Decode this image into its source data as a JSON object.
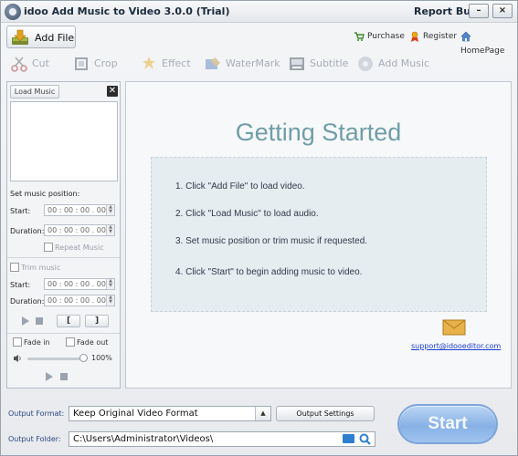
{
  "window": {
    "title": "idoo Add Music to Video 3.0.0 (Trial)",
    "report_bugs": "Report Bugs",
    "minimize": "–",
    "close": "×"
  },
  "toolbar": {
    "add_file": "Add File",
    "links": [
      {
        "label": "Purchase",
        "icon": "cart-icon"
      },
      {
        "label": "Register",
        "icon": "register-icon"
      },
      {
        "label": "HomePage",
        "icon": "home-icon"
      }
    ],
    "tools": [
      {
        "label": "Cut",
        "icon": "scissors-icon"
      },
      {
        "label": "Crop",
        "icon": "crop-icon"
      },
      {
        "label": "Effect",
        "icon": "effect-icon"
      },
      {
        "label": "WaterMark",
        "icon": "watermark-icon"
      },
      {
        "label": "Subtitle",
        "icon": "subtitle-icon"
      },
      {
        "label": "Add Music",
        "icon": "music-disc-icon"
      }
    ]
  },
  "left_panel": {
    "load_music": "Load Music",
    "close": "✕",
    "set_position_label": "Set music position:",
    "start_label": "Start:",
    "duration_label": "Duration:",
    "start_value": "00 : 00 : 00 . 000",
    "duration_value": "00 : 00 : 00 . 000",
    "repeat_music": "Repeat Music",
    "trim_music": "Trim music",
    "trim_start_label": "Start:",
    "trim_duration_label": "Duration:",
    "trim_start_value": "00 : 00 : 00 . 000",
    "trim_duration_value": "00 : 00 : 00 . 000",
    "mark_in": "[",
    "mark_out": "]",
    "fade_in": "Fade in",
    "fade_out": "Fade out",
    "volume_display": "100%",
    "volume_level": 1.0
  },
  "main": {
    "title": "Getting Started",
    "steps": [
      "1. Click \"Add File\" to load video.",
      "2. Click \"Load Music\" to load audio.",
      "3. Set music position or trim music if requested.",
      "4. Click \"Start\" to begin adding music to video."
    ],
    "support_email": "support@idooeditor.com"
  },
  "bottom": {
    "output_format_label": "Output Format:",
    "output_format_value": "Keep Original Video Format",
    "output_settings": "Output Settings",
    "output_folder_label": "Output Folder:",
    "output_folder_value": "C:\\Users\\Administrator\\Videos\\",
    "start": "Start"
  },
  "colors": {
    "title_text": "#6f9ea8",
    "start_button": "#87b1e6",
    "link_blue": "#1a3fd1",
    "disabled_tool": "#a7adb5"
  }
}
